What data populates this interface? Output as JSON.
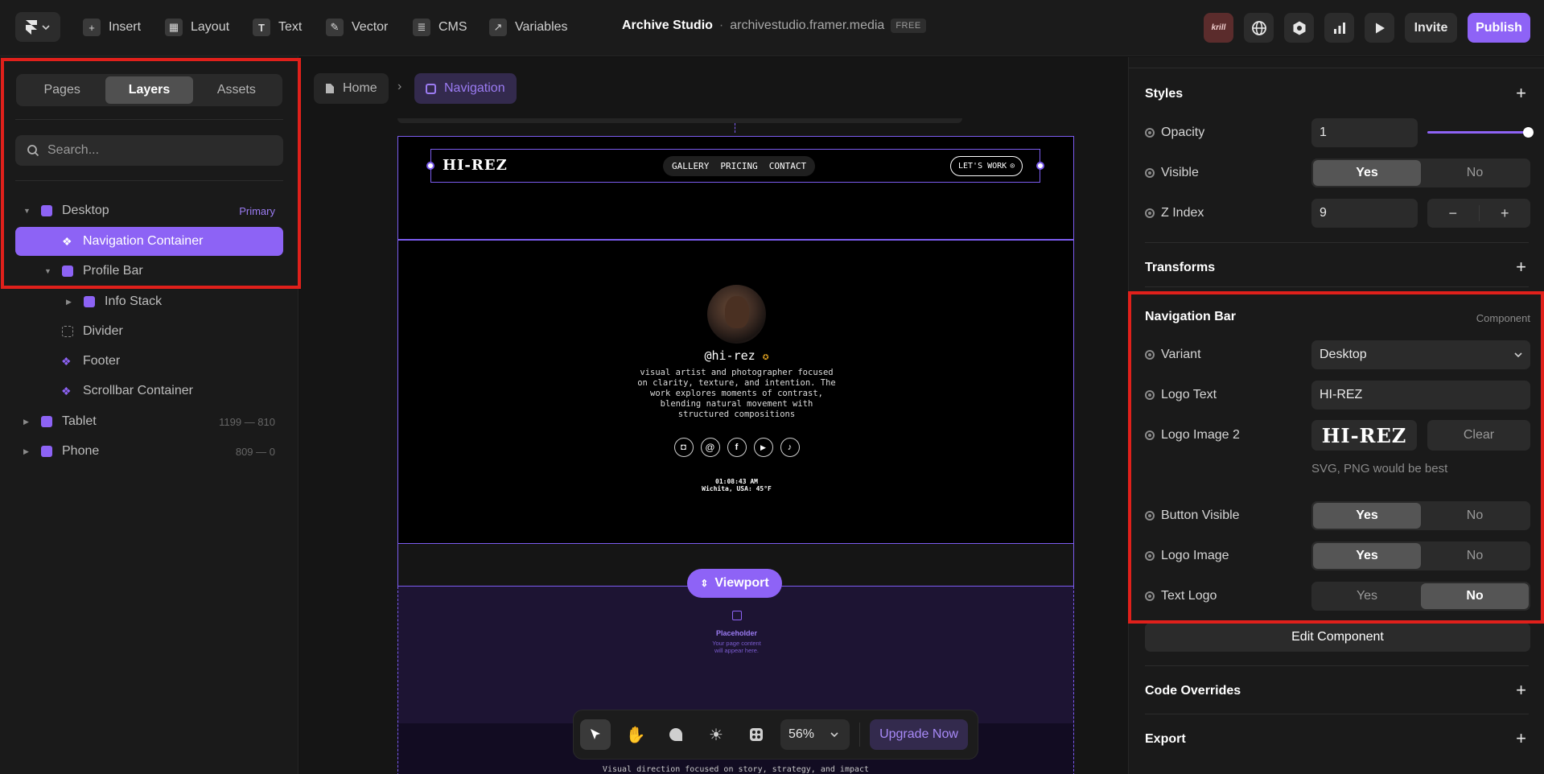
{
  "topbar": {
    "menu": [
      {
        "label": "Insert",
        "icon": "plus-square-icon"
      },
      {
        "label": "Layout",
        "icon": "layout-icon"
      },
      {
        "label": "Text",
        "icon": "text-icon"
      },
      {
        "label": "Vector",
        "icon": "pen-icon"
      },
      {
        "label": "CMS",
        "icon": "database-icon"
      },
      {
        "label": "Variables",
        "icon": "variables-icon"
      }
    ],
    "project_name": "Archive Studio",
    "separator": "·",
    "domain": "archivestudio.framer.media",
    "plan_badge": "FREE",
    "avatar_text": "krill",
    "invite_label": "Invite",
    "publish_label": "Publish",
    "publish_color": "#8e63f6"
  },
  "left_panel": {
    "tabs": [
      "Pages",
      "Layers",
      "Assets"
    ],
    "active_tab": "Layers",
    "search_placeholder": "Search...",
    "layers": [
      {
        "label": "Desktop",
        "meta": "Primary"
      },
      {
        "label": "Navigation Container",
        "meta": ""
      },
      {
        "label": "Profile Bar",
        "meta": ""
      },
      {
        "label": "Info Stack",
        "meta": ""
      },
      {
        "label": "Divider",
        "meta": ""
      },
      {
        "label": "Footer",
        "meta": ""
      },
      {
        "label": "Scrollbar Container",
        "meta": ""
      },
      {
        "label": "Tablet",
        "meta": "1199 — 810"
      },
      {
        "label": "Phone",
        "meta": "809 — 0"
      }
    ]
  },
  "canvas": {
    "breadcrumb_home": "Home",
    "breadcrumb_current": "Navigation",
    "site": {
      "logo": "HI-REZ",
      "nav_links": [
        "GALLERY",
        "PRICING",
        "CONTACT"
      ],
      "cta": "LET'S WORK",
      "handle": "@hi-rez",
      "bio": [
        "visual artist and photographer focused",
        "on clarity, texture, and intention. The",
        "work explores moments of contrast,",
        "blending natural movement with",
        "structured compositions"
      ],
      "time": "01:08:43 AM",
      "location": "Wichita, USA: 45°F",
      "viewport_label": "Viewport",
      "placeholder_title": "Placeholder",
      "placeholder_text": [
        "Your page content",
        "will appear here."
      ],
      "footer_text": "Visual direction focused on story, strategy, and impact"
    },
    "toolbar": {
      "zoom": "56%",
      "upgrade_label": "Upgrade Now"
    }
  },
  "right_panel": {
    "styles": {
      "title": "Styles",
      "opacity_label": "Opacity",
      "opacity_value": "1",
      "visible_label": "Visible",
      "zindex_label": "Z Index",
      "zindex_value": "9"
    },
    "transforms_title": "Transforms",
    "component": {
      "title": "Navigation Bar",
      "tag": "Component",
      "variant_label": "Variant",
      "variant_value": "Desktop",
      "logo_text_label": "Logo Text",
      "logo_text_value": "HI-REZ",
      "logo_image2_label": "Logo Image 2",
      "clear_label": "Clear",
      "logo_hint": "SVG, PNG would be best",
      "button_visible_label": "Button Visible",
      "logo_image_label": "Logo Image",
      "text_logo_label": "Text Logo",
      "yes": "Yes",
      "no": "No",
      "edit_label": "Edit Component"
    },
    "code_overrides_title": "Code Overrides",
    "export_title": "Export"
  }
}
